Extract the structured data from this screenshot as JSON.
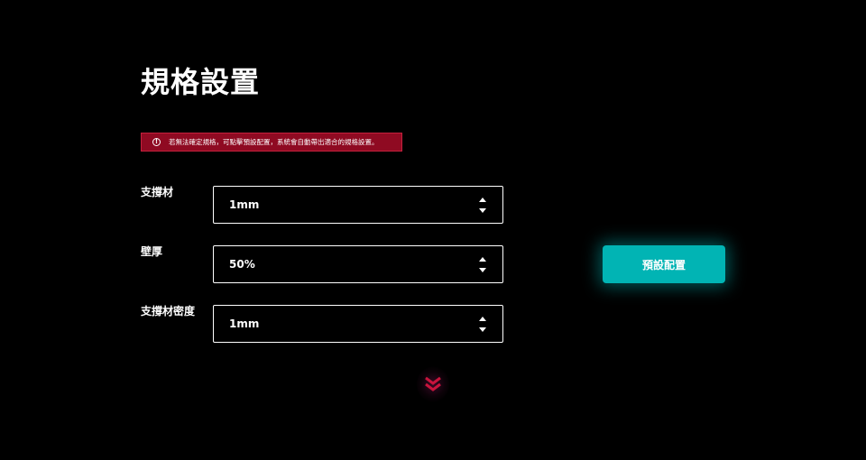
{
  "page": {
    "title": "規格設置",
    "notice": {
      "icon": "info-circle-icon",
      "text": "若無法確定規格，可點擊預設配置，系統會自動帶出適合的規格設置。",
      "background": "#8f0a22"
    }
  },
  "fields": [
    {
      "label": "支撐材",
      "value": "1mm"
    },
    {
      "label": "壁厚",
      "value": "50%"
    },
    {
      "label": "支撐材密度",
      "value": "1mm"
    }
  ],
  "actions": {
    "preset_button_label": "預設配置",
    "accent": "#01b4b4"
  },
  "scroll_hint": {
    "icon": "double-chevron-down-icon",
    "color": "#c8143c"
  }
}
